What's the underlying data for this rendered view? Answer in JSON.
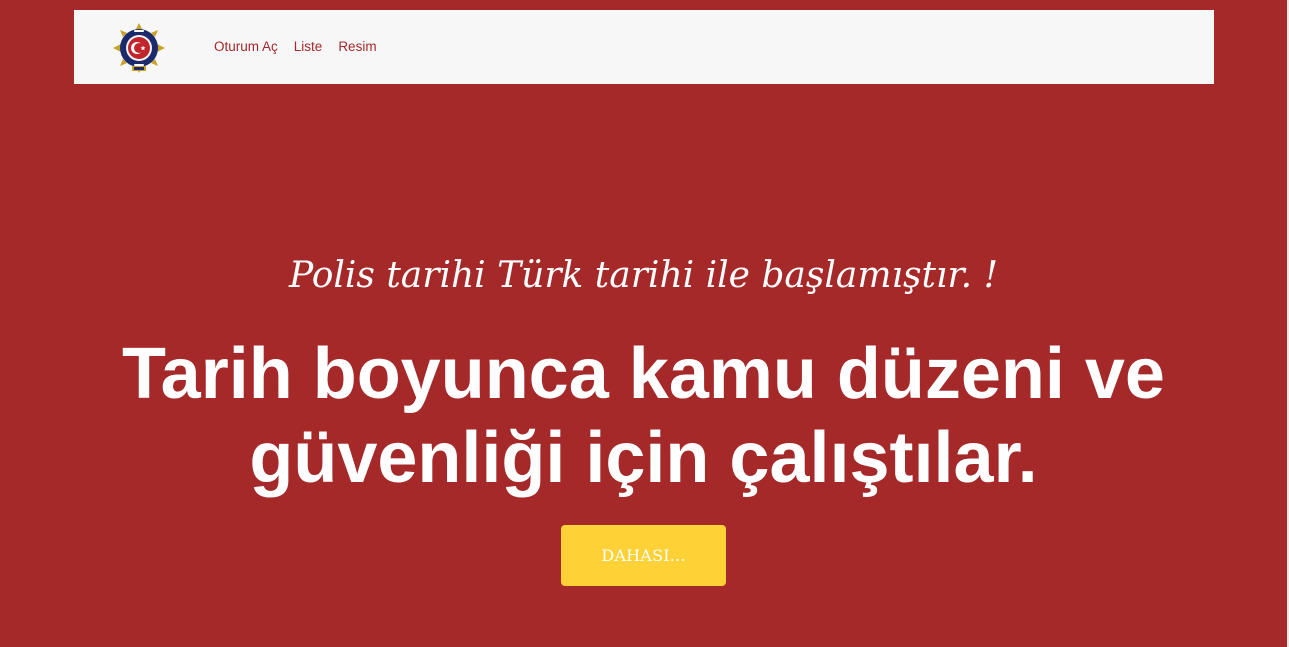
{
  "colors": {
    "background": "#a6292a",
    "navbar_background": "#f7f7f8",
    "nav_link": "#a6292a",
    "button": "#fed136",
    "hero_text": "#ffffff"
  },
  "navbar": {
    "logo_icon": "police-emblem-icon",
    "links": [
      {
        "label": "Oturum Aç"
      },
      {
        "label": "Liste"
      },
      {
        "label": "Resim"
      }
    ]
  },
  "hero": {
    "subtitle": "Polis tarihi Türk tarihi ile başlamıştır. !",
    "title": "Tarih boyunca kamu düzeni ve güvenliği için çalıştılar.",
    "button_label": "DAHASI..."
  }
}
